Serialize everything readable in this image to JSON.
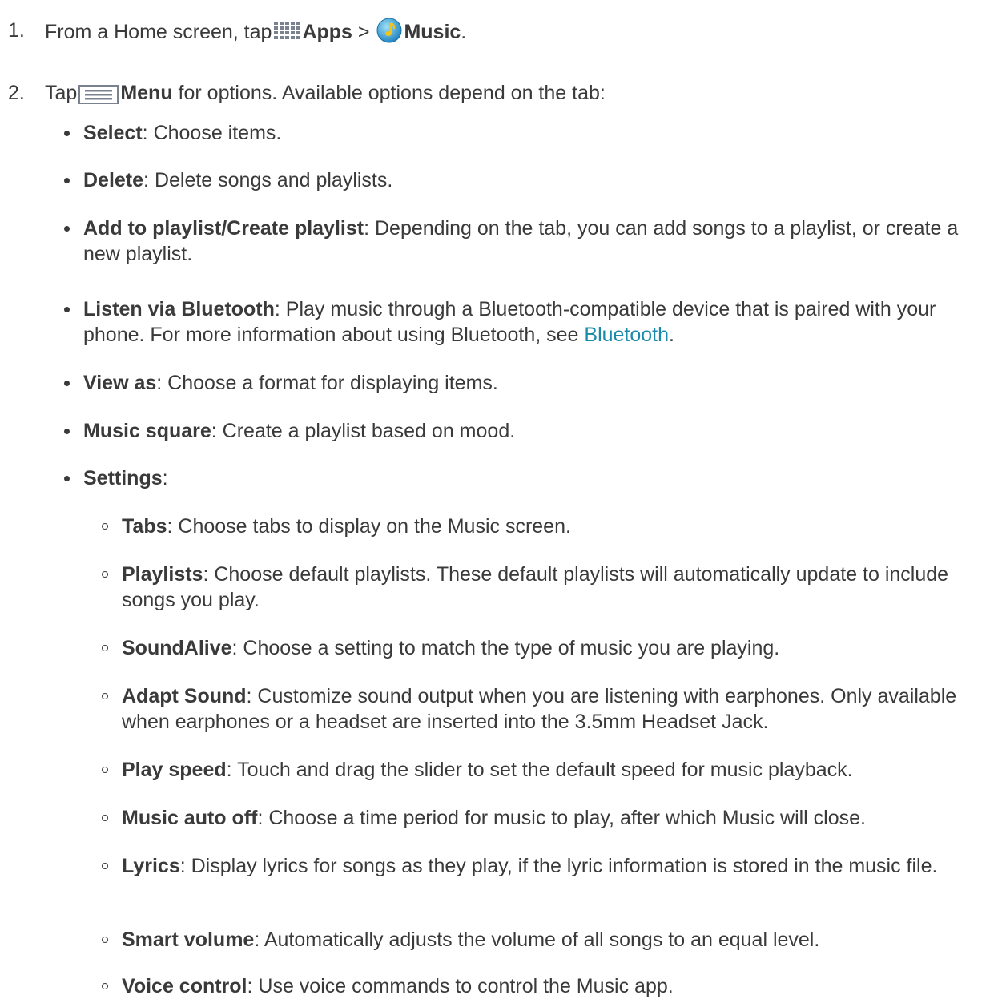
{
  "steps": [
    {
      "num": "1.",
      "pre": "From a Home screen, tap",
      "bold1": "Apps",
      "sep": " > ",
      "bold2": "Music",
      "post": "."
    },
    {
      "num": "2.",
      "pre": "Tap",
      "bold1": "Menu",
      "post": " for options. Available options depend on the tab:"
    }
  ],
  "options": [
    {
      "label": "Select",
      "text": ": Choose items."
    },
    {
      "label": "Delete",
      "text": ": Delete songs and playlists."
    },
    {
      "label": "Add to playlist/Create playlist",
      "text": ": Depending on the tab, you can add songs to a playlist, or create a new playlist."
    },
    {
      "label": "Listen via Bluetooth",
      "text": ": Play music through a Bluetooth-compatible device that is paired with your phone. For more information about using Bluetooth, see ",
      "link": "Bluetooth",
      "tail": "."
    },
    {
      "label": "View as",
      "text": ": Choose a format for displaying items."
    },
    {
      "label": "Music square",
      "text": ": Create a playlist based on mood."
    },
    {
      "label": "Settings",
      "text": ":"
    }
  ],
  "settings": [
    {
      "label": "Tabs",
      "text": ": Choose tabs to display on the Music screen."
    },
    {
      "label": "Playlists",
      "text": ": Choose default playlists. These default playlists will automatically update to include songs you play."
    },
    {
      "label": "SoundAlive",
      "text": ": Choose a setting to match the type of music you are playing."
    },
    {
      "label": "Adapt Sound",
      "text": ": Customize sound output when you are listening with earphones. Only available when earphones or a headset are inserted into the 3.5mm Headset Jack."
    },
    {
      "label": "Play speed",
      "text": ": Touch and drag the slider to set the default speed for music playback."
    },
    {
      "label": "Music auto off",
      "text": ": Choose a time period for music to play, after which Music will close."
    },
    {
      "label": "Lyrics",
      "text": ": Display lyrics for songs as they play, if the lyric information is stored in the music file."
    },
    {
      "label": "Smart volume",
      "text": ": Automatically adjusts the volume of all songs to an equal level."
    },
    {
      "label": "Voice control",
      "text": ": Use voice commands to control the Music app."
    }
  ],
  "icons": {
    "apps": "apps-grid-icon",
    "music": "music-note-icon",
    "menu": "menu-icon"
  },
  "colors": {
    "text": "#3a3a3a",
    "link": "#1a8aaa",
    "music_icon": "#f0c419"
  }
}
